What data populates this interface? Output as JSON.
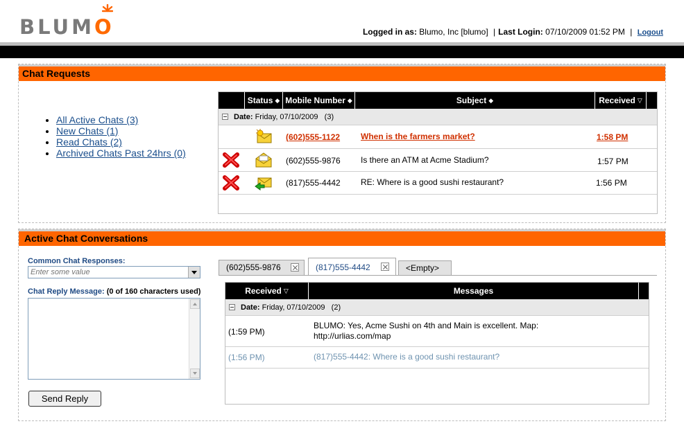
{
  "brand": {
    "logo_text": "BLUMO",
    "accent": "#ff6500"
  },
  "header": {
    "logged_in_label": "Logged in as:",
    "account": "Blumo, Inc [blumo]",
    "last_login_label": "Last Login:",
    "last_login_value": "07/10/2009 01:52 PM",
    "logout": "Logout"
  },
  "chat_requests": {
    "title": "Chat Requests",
    "links": [
      "All Active Chats (3)",
      "New Chats (1)",
      "Read Chats (2)",
      "Archived Chats Past 24hrs (0)"
    ],
    "columns": {
      "status": "Status",
      "mobile": "Mobile Number",
      "subject": "Subject",
      "received": "Received"
    },
    "group": {
      "label": "Date:",
      "date": "Friday, 07/10/2009",
      "count": "(3)"
    },
    "rows": [
      {
        "mobile": "(602)555-1122",
        "subject": "When is the farmers market?",
        "received": "1:58 PM",
        "status_icon": "new-message-icon"
      },
      {
        "mobile": "(602)555-9876",
        "subject": "Is there an ATM at Acme Stadium?",
        "received": "1:57 PM",
        "status_icon": "read-message-icon"
      },
      {
        "mobile": "(817)555-4442",
        "subject": "RE: Where is a good sushi restaurant?",
        "received": "1:56 PM",
        "status_icon": "replied-message-icon"
      }
    ]
  },
  "active_chats": {
    "title": "Active Chat Conversations",
    "common_responses_label": "Common Chat Responses:",
    "common_responses_placeholder": "Enter some value",
    "reply_label": "Chat Reply Message:",
    "reply_count": "(0 of 160 characters used)",
    "send_button": "Send Reply",
    "tabs": [
      "(602)555-9876",
      "(817)555-4442",
      "<Empty>"
    ],
    "columns": {
      "received": "Received",
      "messages": "Messages"
    },
    "group": {
      "label": "Date:",
      "date": "Friday, 07/10/2009",
      "count": "(2)"
    },
    "messages": [
      {
        "time": "(1:59 PM)",
        "text_line1": "BLUMO: Yes, Acme Sushi on 4th and Main is excellent. Map:",
        "text_line2": "http://urlias.com/map"
      },
      {
        "time": "(1:56 PM)",
        "text": "(817)555-4442: Where is a good sushi restaurant?"
      }
    ]
  }
}
